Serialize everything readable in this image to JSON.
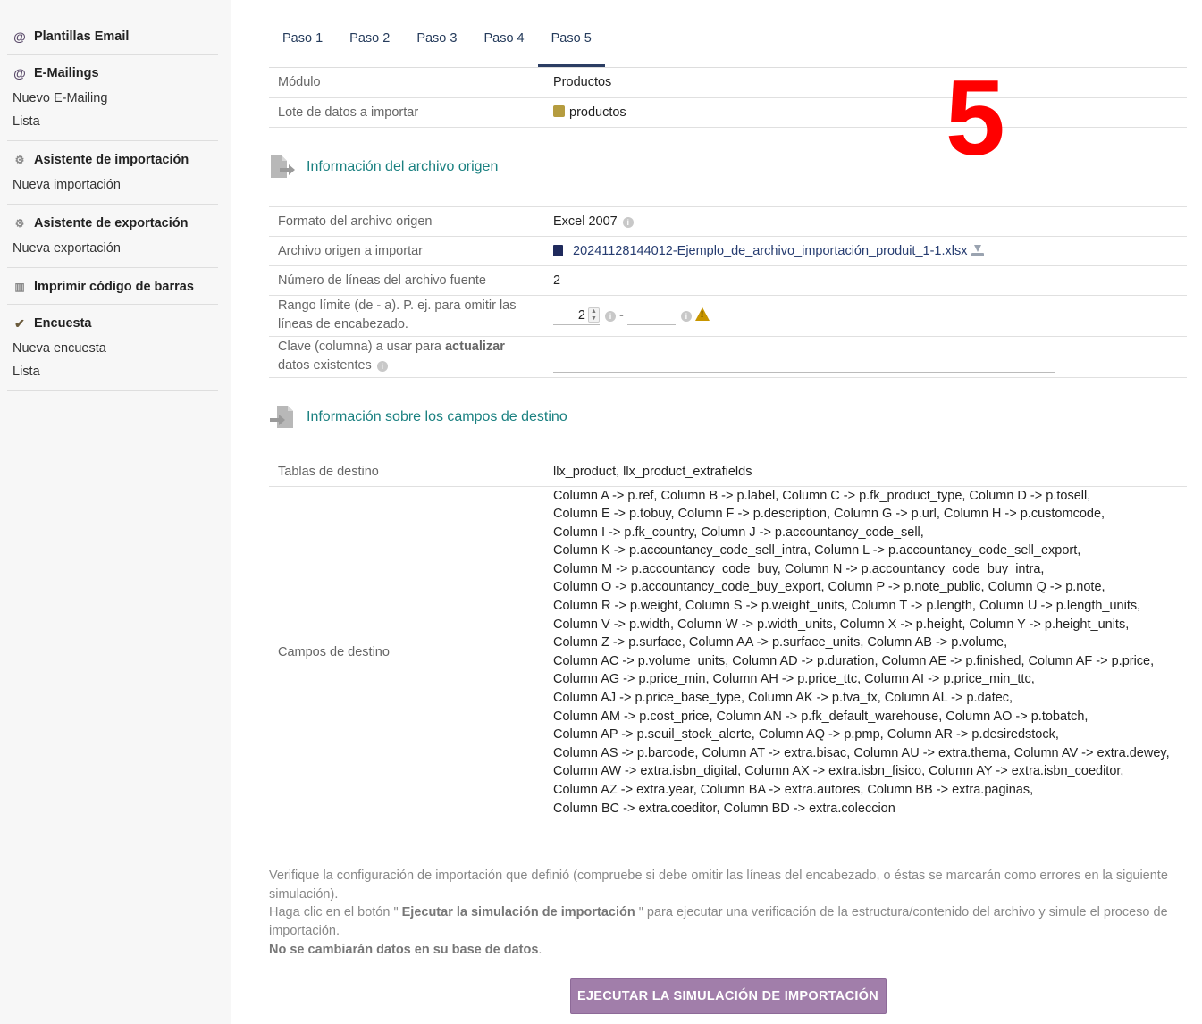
{
  "sidebar": {
    "blocks": [
      {
        "title": "Plantillas Email",
        "icon": "at-icon",
        "links": []
      },
      {
        "title": "E-Mailings",
        "icon": "at-icon",
        "links": [
          "Nuevo E-Mailing",
          "Lista"
        ]
      },
      {
        "title": "Asistente de importación",
        "icon": "gears-icon",
        "links": [
          "Nueva importación"
        ]
      },
      {
        "title": "Asistente de exportación",
        "icon": "gears-icon",
        "links": [
          "Nueva exportación"
        ]
      },
      {
        "title": "Imprimir código de barras",
        "icon": "barcode-icon",
        "links": []
      },
      {
        "title": "Encuesta",
        "icon": "check-icon",
        "links": [
          "Nueva encuesta",
          "Lista"
        ]
      }
    ]
  },
  "tabs": [
    "Paso 1",
    "Paso 2",
    "Paso 3",
    "Paso 4",
    "Paso 5"
  ],
  "active_tab": "Paso 5",
  "step_marker": "5",
  "summary": {
    "modulo_label": "Módulo",
    "modulo_value": "Productos",
    "lote_label": "Lote de datos a importar",
    "lote_value": "productos"
  },
  "source_section": {
    "title": "Información del archivo origen",
    "formato_label": "Formato del archivo origen",
    "formato_value": "Excel 2007",
    "archivo_label": "Archivo origen a importar",
    "archivo_value": "20241128144012-Ejemplo_de_archivo_importación_produit_1-1.xlsx",
    "lineas_label": "Número de líneas del archivo fuente",
    "lineas_value": "2",
    "rango_label": "Rango límite (de - a). P. ej. para omitir las líneas de encabezado.",
    "rango_from": "2",
    "rango_sep": "-",
    "clave_label_a": "Clave (columna) a usar para ",
    "clave_label_b": "actualizar",
    "clave_label_c": " datos existentes"
  },
  "target_section": {
    "title": "Información sobre los campos de destino",
    "tablas_label": "Tablas de destino",
    "tablas_value": "llx_product, llx_product_extrafields",
    "campos_label": "Campos de destino",
    "campos_lines": [
      "Column A -> p.ref, Column B -> p.label, Column C -> p.fk_product_type, Column D -> p.tosell,",
      "Column E -> p.tobuy, Column F -> p.description, Column G -> p.url, Column H -> p.customcode,",
      "Column I -> p.fk_country, Column J -> p.accountancy_code_sell,",
      "Column K -> p.accountancy_code_sell_intra, Column L -> p.accountancy_code_sell_export,",
      "Column M -> p.accountancy_code_buy, Column N -> p.accountancy_code_buy_intra,",
      "Column O -> p.accountancy_code_buy_export, Column P -> p.note_public, Column Q -> p.note,",
      "Column R -> p.weight, Column S -> p.weight_units, Column T -> p.length, Column U -> p.length_units,",
      "Column V -> p.width, Column W -> p.width_units, Column X -> p.height, Column Y -> p.height_units,",
      "Column Z -> p.surface, Column AA -> p.surface_units, Column AB -> p.volume,",
      "Column AC -> p.volume_units, Column AD -> p.duration, Column AE -> p.finished, Column AF -> p.price,",
      "Column AG -> p.price_min, Column AH -> p.price_ttc, Column AI -> p.price_min_ttc,",
      "Column AJ -> p.price_base_type, Column AK -> p.tva_tx, Column AL -> p.datec,",
      "Column AM -> p.cost_price, Column AN -> p.fk_default_warehouse, Column AO -> p.tobatch,",
      "Column AP -> p.seuil_stock_alerte, Column AQ -> p.pmp, Column AR -> p.desiredstock,",
      "Column AS -> p.barcode, Column AT -> extra.bisac, Column AU -> extra.thema, Column AV -> extra.dewey,",
      "Column AW -> extra.isbn_digital, Column AX -> extra.isbn_fisico, Column AY -> extra.isbn_coeditor,",
      "Column AZ -> extra.year, Column BA -> extra.autores, Column BB -> extra.paginas,",
      "Column BC -> extra.coeditor, Column BD -> extra.coleccion"
    ]
  },
  "notice": {
    "line1": "Verifique la configuración de importación que definió (compruebe si debe omitir las líneas del encabezado, o éstas se marcarán como errores en la siguiente simulación).",
    "line2_a": "Haga clic en el botón \" ",
    "line2_b": "Ejecutar la simulación de importación",
    "line2_c": " \" para ejecutar una verificación de la estructura/contenido del archivo y simule el proceso de importación.",
    "line3": "No se cambiarán datos en su base de datos",
    "line3_end": "."
  },
  "button_label": "EJECUTAR LA SIMULACIÓN DE IMPORTACIÓN"
}
